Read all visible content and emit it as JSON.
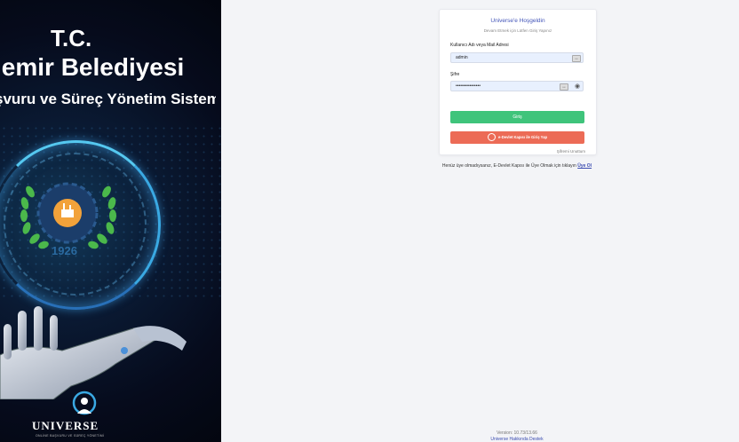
{
  "hero": {
    "line1": "T.C.",
    "line2": "iemir Belediyesi",
    "line3": "şvuru ve Süreç Yönetim Sistemi",
    "emblem_year": "1926",
    "brand": "UNIVERSE",
    "brand_sub": "ONLİNE BAŞVURU VE SÜREÇ YÖNETİMİ"
  },
  "login": {
    "welcome": "Universe'e Hoşgeldin",
    "welcome_sub": "Devam Etmek için Lütfen Giriş Yapınız",
    "username_label": "Kullanıcı Adı veya Mail Adresi",
    "username_value": "admin",
    "password_label": "Şifre",
    "password_value": "••••••••••••••••",
    "login_button": "Giriş",
    "edevlet_button": "e-Devlet Kapısı ile Giriş Yap",
    "forgot_password": "Şifremi Unuttum"
  },
  "register": {
    "text": "Henüz üye olmadıysanız, E-Devlet Kapısı ile Üye Olmak için tıklayın",
    "link": "Üye Ol"
  },
  "footer": {
    "version": "Version: 10.73/13.66",
    "support": "Universe Hakkında Destek"
  },
  "colors": {
    "accent": "#4254b8",
    "login_button": "#3fc47b",
    "edevlet_button": "#ec6b56"
  }
}
